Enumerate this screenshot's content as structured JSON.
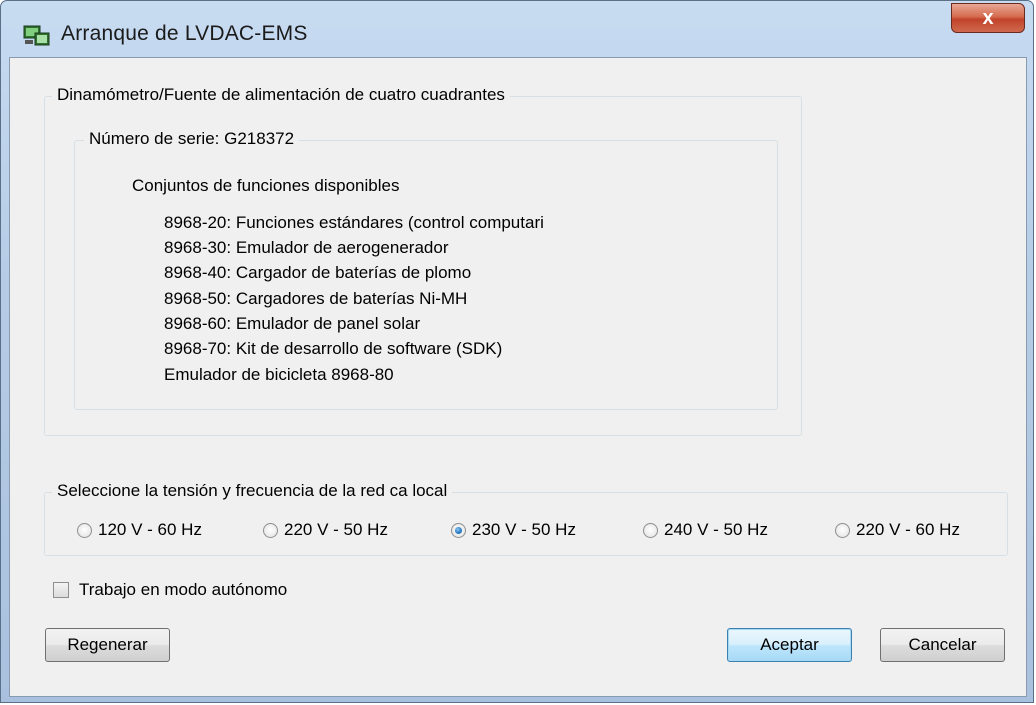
{
  "window": {
    "title": "Arranque de LVDAC-EMS",
    "close_label": "x"
  },
  "device_group": {
    "caption": "Dinamómetro/Fuente de alimentación de cuatro cuadrantes",
    "serial_caption": "Número de serie: G218372",
    "functions_heading": "Conjuntos de funciones disponibles",
    "functions": [
      "8968-20:  Funciones  estándares  (control computari",
      "8968-30: Emulador de aerogenerador",
      "8968-40: Cargador de baterías de plomo",
      "8968-50: Cargadores de baterías Ni-MH",
      "8968-60: Emulador de panel solar",
      "8968-70: Kit de desarrollo de software (SDK)",
      "Emulador de bicicleta 8968-80"
    ]
  },
  "network_group": {
    "caption": "Seleccione la tensión y frecuencia de la red ca local",
    "options": [
      {
        "label": "120 V - 60 Hz",
        "selected": false
      },
      {
        "label": "220 V - 50 Hz",
        "selected": false
      },
      {
        "label": "230 V - 50 Hz",
        "selected": true
      },
      {
        "label": "240 V - 50 Hz",
        "selected": false
      },
      {
        "label": "220 V - 60 Hz",
        "selected": false
      }
    ]
  },
  "standalone": {
    "label": "Trabajo en modo autónomo",
    "checked": false
  },
  "buttons": {
    "regenerate": "Regenerar",
    "accept": "Aceptar",
    "cancel": "Cancelar"
  }
}
